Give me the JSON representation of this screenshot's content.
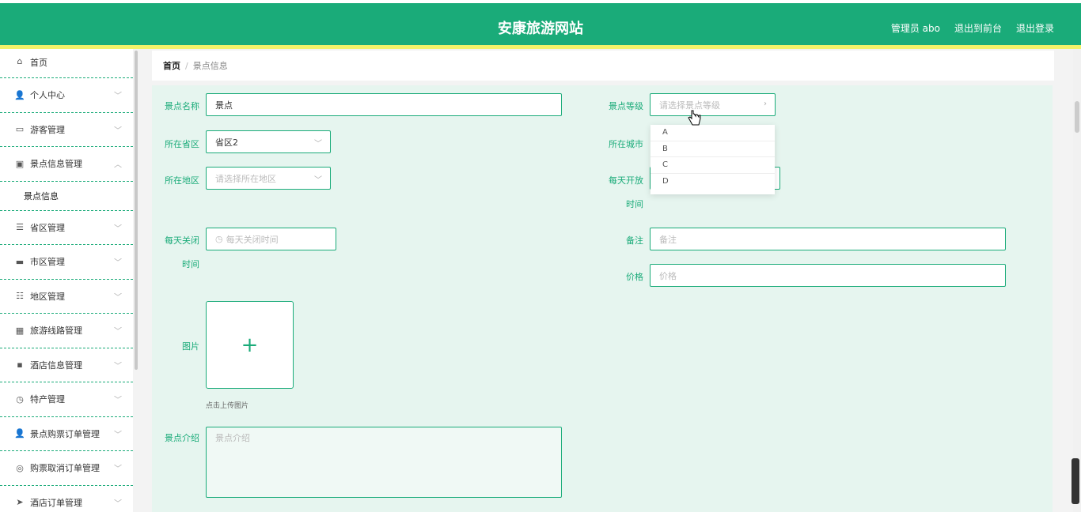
{
  "header": {
    "title": "安康旅游网站",
    "admin": "管理员 abo",
    "to_front": "退出到前台",
    "logout": "退出登录"
  },
  "sidebar": {
    "items": [
      {
        "label": "首页",
        "icon": "home-icon",
        "glyph": "⌂"
      },
      {
        "label": "个人中心",
        "icon": "user-icon",
        "glyph": "👤"
      },
      {
        "label": "游客管理",
        "icon": "id-card-icon",
        "glyph": "▭"
      },
      {
        "label": "景点信息管理",
        "icon": "clipboard-icon",
        "glyph": "▣"
      },
      {
        "label": "景点信息",
        "icon": "",
        "glyph": ""
      },
      {
        "label": "省区管理",
        "icon": "list-icon",
        "glyph": "☰"
      },
      {
        "label": "市区管理",
        "icon": "monitor-icon",
        "glyph": "▬"
      },
      {
        "label": "地区管理",
        "icon": "sliders-icon",
        "glyph": "☷"
      },
      {
        "label": "旅游线路管理",
        "icon": "ticket-icon",
        "glyph": "▦"
      },
      {
        "label": "酒店信息管理",
        "icon": "comment-icon",
        "glyph": "▪"
      },
      {
        "label": "特产管理",
        "icon": "clock-icon",
        "glyph": "◷"
      },
      {
        "label": "景点购票订单管理",
        "icon": "user-icon",
        "glyph": "👤"
      },
      {
        "label": "购票取消订单管理",
        "icon": "compass-icon",
        "glyph": "◎"
      },
      {
        "label": "酒店订单管理",
        "icon": "send-icon",
        "glyph": "➤"
      }
    ]
  },
  "breadcrumb": {
    "home": "首页",
    "sep": "/",
    "current": "景点信息"
  },
  "form": {
    "name_label": "景点名称",
    "name_value": "景点",
    "level_label": "景点等级",
    "level_placeholder": "请选择景点等级",
    "province_label": "所在省区",
    "province_value": "省区2",
    "city_label": "所在城市",
    "region_label": "所在地区",
    "region_placeholder": "请选择所在地区",
    "open_label_1": "每天开放",
    "open_label_2": "时间",
    "close_label_1": "每天关闭",
    "close_label_2": "时间",
    "close_placeholder": "每天关闭时间",
    "note_label": "备注",
    "note_placeholder": "备注",
    "price_label": "价格",
    "price_placeholder": "价格",
    "image_label": "图片",
    "upload_hint": "点击上传图片",
    "intro_label": "景点介绍",
    "intro_placeholder": "景点介绍"
  },
  "level_options": [
    "A",
    "B",
    "C",
    "D"
  ],
  "colors": {
    "accent": "#1aab79",
    "yellow": "#f2f26a",
    "form_bg": "#e6f5ef"
  }
}
